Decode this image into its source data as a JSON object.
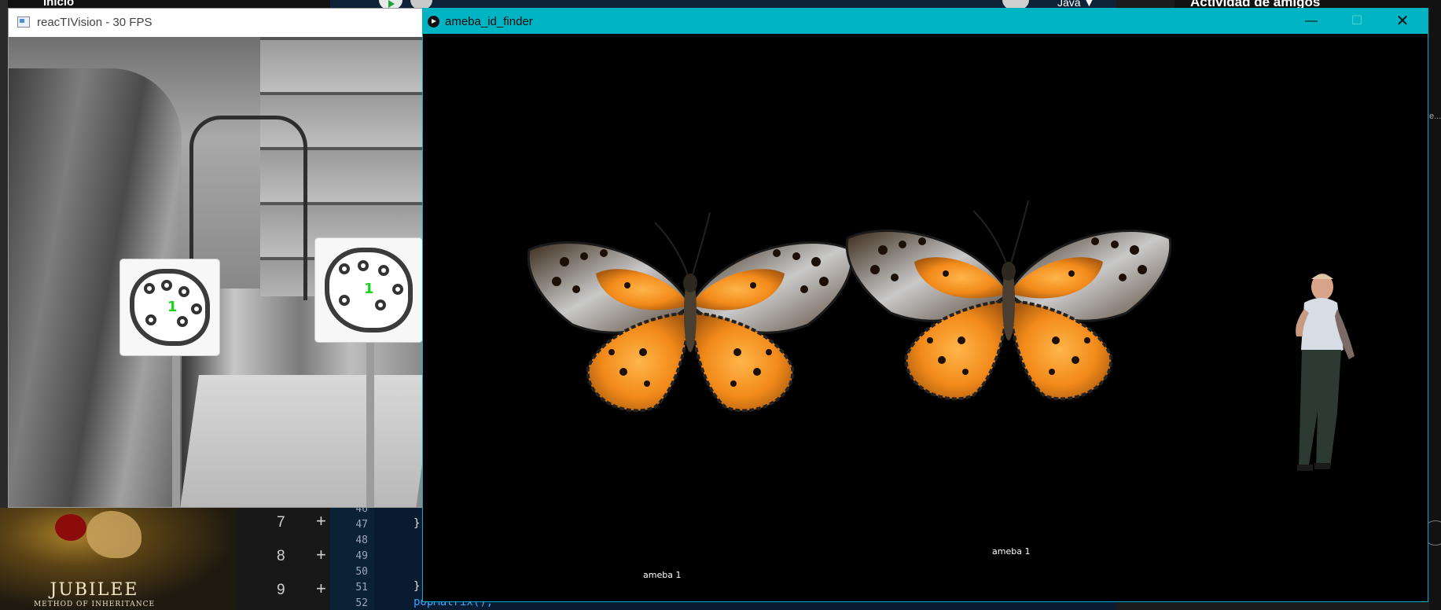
{
  "background": {
    "spotify": {
      "top_label": "Inicio",
      "album_title": "JUBILEE",
      "album_subtitle": "METHOD OF INHERITANCE",
      "tracks": [
        "7",
        "8",
        "9"
      ],
      "add_symbol": "+"
    },
    "ide": {
      "language": "Java ▼",
      "line_numbers": [
        "46",
        "47",
        "48",
        "49",
        "50",
        "51",
        "52"
      ],
      "code_lines": [
        "}",
        "",
        "",
        "",
        "}",
        "popMatrix();"
      ]
    },
    "friends_panel": {
      "title": "Actividad de amigos",
      "ellipsis": "e..."
    }
  },
  "react_window": {
    "title": "reacTIVision - 30 FPS",
    "fiducial_ids": [
      "1",
      "1"
    ]
  },
  "ameba_window": {
    "title": "ameba_id_finder",
    "controls": {
      "minimize": "—",
      "maximize": "☐",
      "close": "✕"
    },
    "labels": [
      "ameba 1",
      "ameba 1"
    ]
  },
  "colors": {
    "ameba_titlebar": "#00b4c4",
    "fiducial_id": "#1fd21f",
    "ide_background": "#081b30"
  }
}
